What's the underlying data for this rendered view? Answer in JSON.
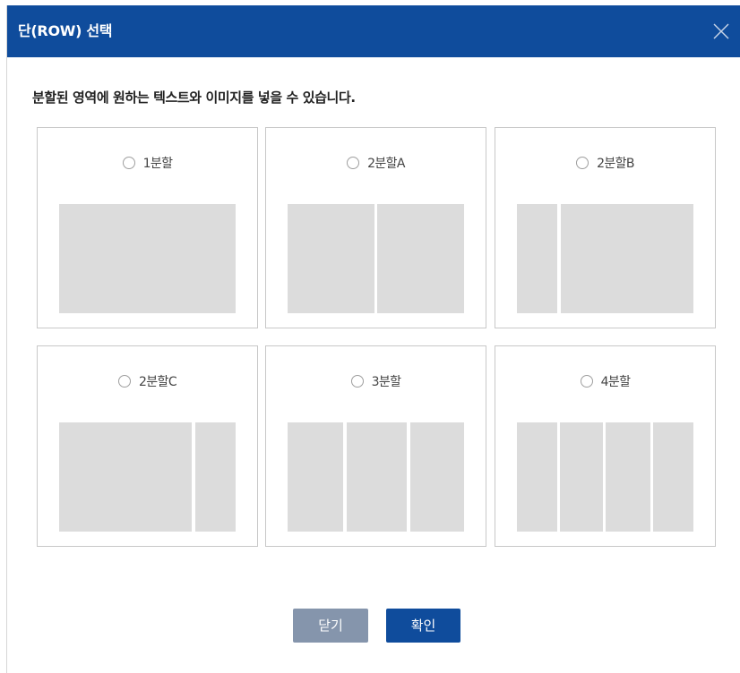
{
  "dialog": {
    "title": "단(ROW) 선택",
    "description": "분할된 영역에 원하는 텍스트와 이미지를 넣을 수 있습니다."
  },
  "options": [
    {
      "label": "1분할",
      "selected": false
    },
    {
      "label": "2분할A",
      "selected": false
    },
    {
      "label": "2분할B",
      "selected": false
    },
    {
      "label": "2분할C",
      "selected": false
    },
    {
      "label": "3분할",
      "selected": false
    },
    {
      "label": "4분할",
      "selected": false
    }
  ],
  "buttons": {
    "close_label": "닫기",
    "confirm_label": "확인"
  },
  "colors": {
    "header": "#0f4c9c",
    "confirm_button": "#0f4c9c",
    "close_button": "#8595ac",
    "preview_block": "#dcdcdc"
  },
  "icons": {
    "close": "close-icon",
    "radio": "radio-icon"
  }
}
